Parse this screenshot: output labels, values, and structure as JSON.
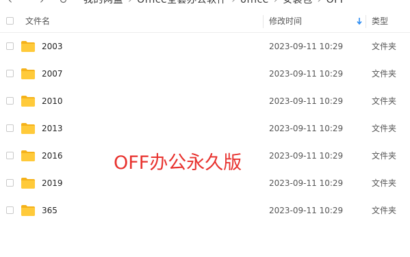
{
  "nav": {
    "back_icon": "chevron-left-icon",
    "forward_icon": "chevron-right-icon",
    "refresh_icon": "refresh-icon",
    "breadcrumbs": [
      "我的网盘",
      "Office全套办公软件",
      "office",
      "安装包",
      "OFF"
    ]
  },
  "table": {
    "headers": {
      "name": "文件名",
      "modified": "修改时间",
      "type": "类型"
    },
    "sort_icon": "sort-down-icon",
    "rows": [
      {
        "name": "2003",
        "modified": "2023-09-11 10:29",
        "type": "文件夹"
      },
      {
        "name": "2007",
        "modified": "2023-09-11 10:29",
        "type": "文件夹"
      },
      {
        "name": "2010",
        "modified": "2023-09-11 10:29",
        "type": "文件夹"
      },
      {
        "name": "2013",
        "modified": "2023-09-11 10:29",
        "type": "文件夹"
      },
      {
        "name": "2016",
        "modified": "2023-09-11 10:29",
        "type": "文件夹"
      },
      {
        "name": "2019",
        "modified": "2023-09-11 10:29",
        "type": "文件夹"
      },
      {
        "name": "365",
        "modified": "2023-09-11 10:29",
        "type": "文件夹"
      }
    ]
  },
  "overlay_text": "OFF办公永久版",
  "colors": {
    "accent": "#2b8cf2",
    "overlay": "#e8332f",
    "folder": "#ffc83d"
  }
}
